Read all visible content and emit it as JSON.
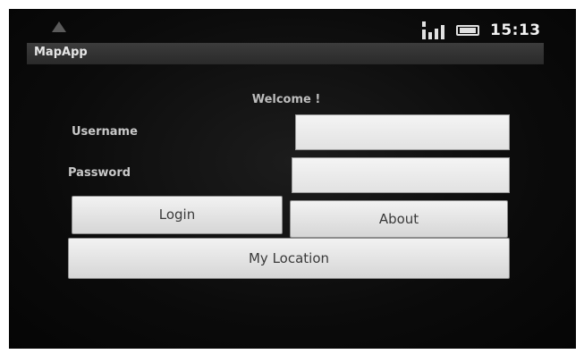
{
  "status_bar": {
    "time": "15:13",
    "icons": [
      "notification-icon",
      "signal-icon",
      "battery-icon"
    ]
  },
  "app": {
    "title": "MapApp"
  },
  "login_form": {
    "welcome": "Welcome !",
    "username_label": "Username",
    "username_value": "",
    "password_label": "Password",
    "password_value": "",
    "login_button": "Login",
    "about_button": "About",
    "location_button": "My Location"
  }
}
